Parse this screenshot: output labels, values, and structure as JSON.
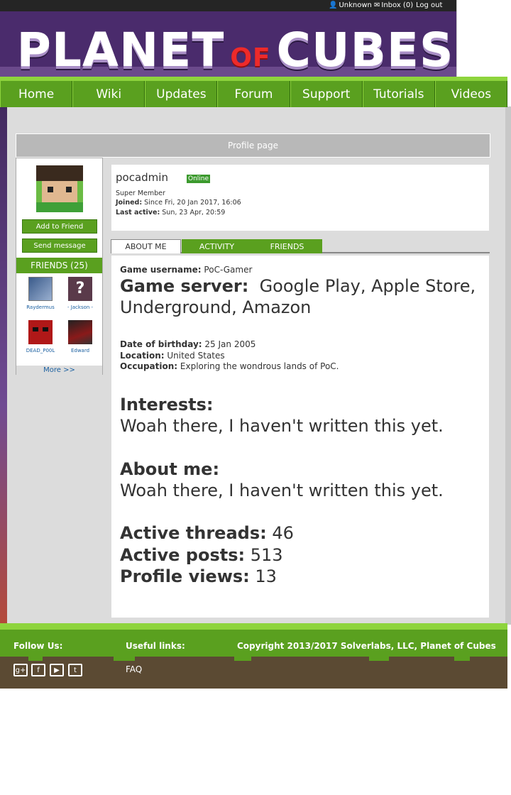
{
  "topbar": {
    "user": "Unknown",
    "inbox": "Inbox (0)",
    "logout": "Log out"
  },
  "banner": {
    "logo_word1": "PLANET",
    "logo_of": "OF",
    "logo_word2": "CUBES"
  },
  "nav": [
    "Home",
    "Wiki",
    "Updates",
    "Forum",
    "Support",
    "Tutorials",
    "Videos"
  ],
  "page_title": "Profile page",
  "sidebar": {
    "add_friend": "Add to Friend",
    "send_message": "Send message",
    "friends_header": "FRIENDS (25)",
    "friends": [
      "Raydermus",
      "- Jackson -",
      "DEAD_P00L",
      "Edward"
    ],
    "more": "More >>"
  },
  "profile": {
    "username": "pocadmin",
    "status": "Online",
    "rank": "Super Member",
    "joined_label": "Joined:",
    "joined": "Since Fri, 20 Jan 2017, 16:06",
    "last_active_label": "Last active:",
    "last_active": "Sun, 23 Apr, 20:59"
  },
  "tabs": [
    "ABOUT ME",
    "ACTIVITY",
    "FRIENDS"
  ],
  "about": {
    "game_username_label": "Game username:",
    "game_username": "PoC-Gamer",
    "game_server_label": "Game server:",
    "game_server_line1": "Google Play, Apple Store,",
    "game_server_line2": "Underground, Amazon",
    "birthday_label": "Date of birthday:",
    "birthday": "25 Jan 2005",
    "location_label": "Location:",
    "location": "United States",
    "occupation_label": "Occupation:",
    "occupation": "Exploring the wondrous lands of PoC.",
    "interests_label": "Interests:",
    "interests": "Woah there, I haven't written this yet.",
    "aboutme_label": "About me:",
    "aboutme": "Woah there, I haven't written this yet.",
    "threads_label": "Active threads:",
    "threads": "46",
    "posts_label": "Active posts:",
    "posts": "513",
    "views_label": "Profile views:",
    "views": "13"
  },
  "footer": {
    "follow": "Follow Us:",
    "useful": "Useful links:",
    "copyright": "Copyright 2013/2017 Solverlabs, LLC, Planet of Cubes",
    "faq": "FAQ"
  },
  "colors": {
    "green": "#5aa01f",
    "banner": "#4a2b6c",
    "online": "#3c9a2e",
    "link": "#1a5fa0"
  },
  "icons": [
    "user-icon",
    "envelope-icon",
    "google-plus-icon",
    "facebook-icon",
    "youtube-icon",
    "twitter-icon"
  ]
}
